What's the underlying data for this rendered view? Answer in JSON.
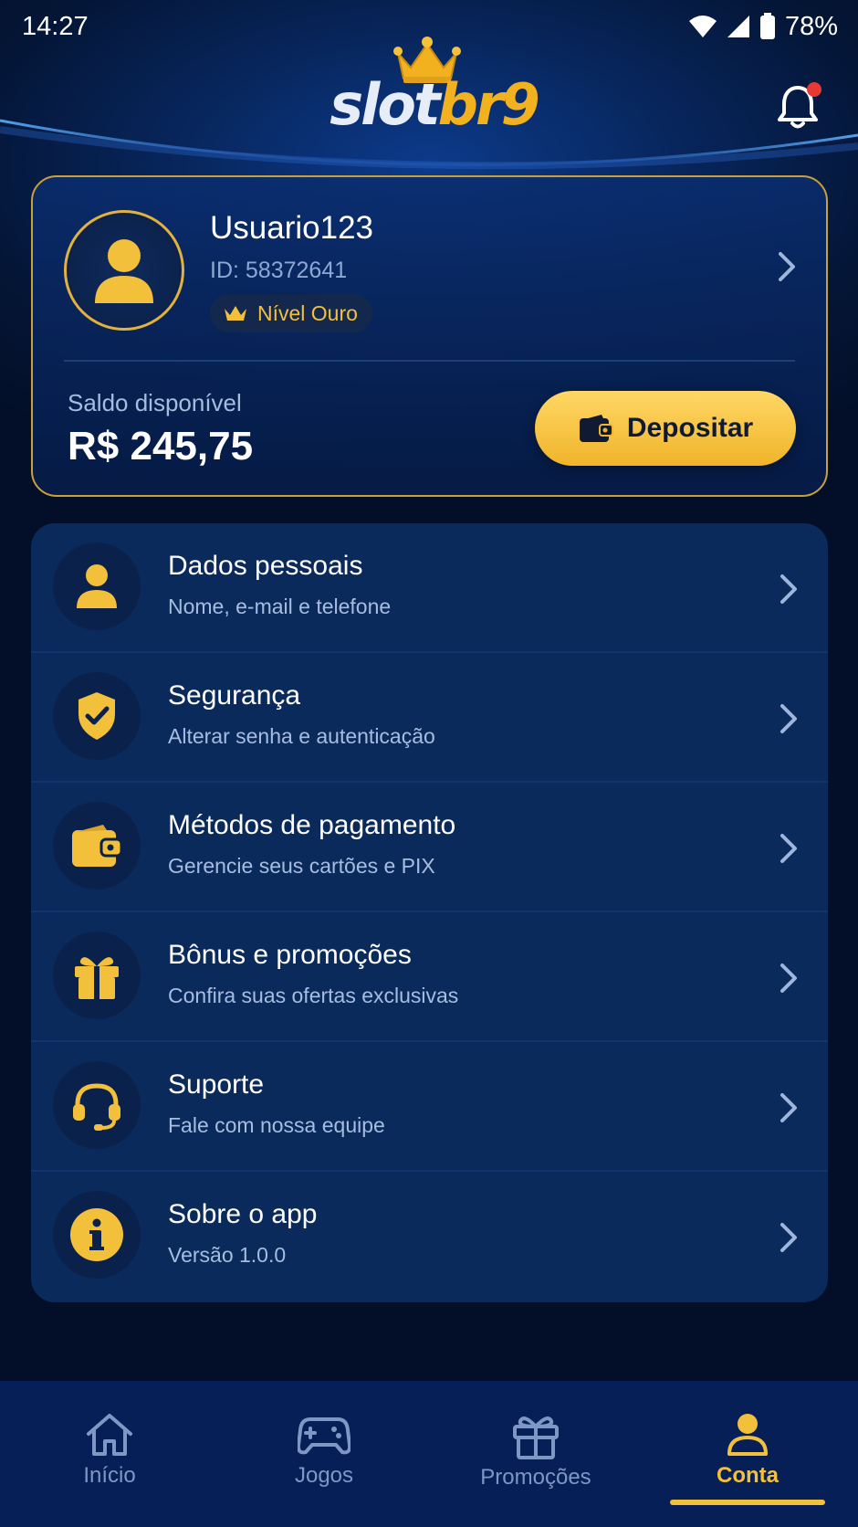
{
  "status_bar": {
    "time": "14:27",
    "battery": "78%"
  },
  "header": {
    "logo_part1": "slot",
    "logo_part2": "br9"
  },
  "profile": {
    "username": "Usuario123",
    "id_text": "ID: 58372641",
    "level": "Nível Ouro",
    "balance_label": "Saldo disponível",
    "balance_value": "R$ 245,75",
    "deposit_label": "Depositar"
  },
  "menu": {
    "items": [
      {
        "title": "Dados pessoais",
        "subtitle": "Nome, e-mail e telefone",
        "icon": "person-icon"
      },
      {
        "title": "Segurança",
        "subtitle": "Alterar senha e autenticação",
        "icon": "shield-check-icon"
      },
      {
        "title": "Métodos de pagamento",
        "subtitle": "Gerencie seus cartões e PIX",
        "icon": "wallet-icon"
      },
      {
        "title": "Bônus e promoções",
        "subtitle": "Confira suas ofertas exclusivas",
        "icon": "gift-icon"
      },
      {
        "title": "Suporte",
        "subtitle": "Fale com nossa equipe",
        "icon": "headset-icon"
      },
      {
        "title": "Sobre o app",
        "subtitle": "Versão 1.0.0",
        "icon": "info-icon"
      }
    ]
  },
  "nav": {
    "items": [
      {
        "label": "Início",
        "icon": "home-icon"
      },
      {
        "label": "Jogos",
        "icon": "gamepad-icon"
      },
      {
        "label": "Promoções",
        "icon": "gift-icon"
      },
      {
        "label": "Conta",
        "icon": "person-icon",
        "active": true
      }
    ]
  },
  "colors": {
    "accent_gold": "#f2c03b",
    "background": "#041535",
    "card": "#0b2a5c",
    "notification_dot": "#e53935"
  }
}
